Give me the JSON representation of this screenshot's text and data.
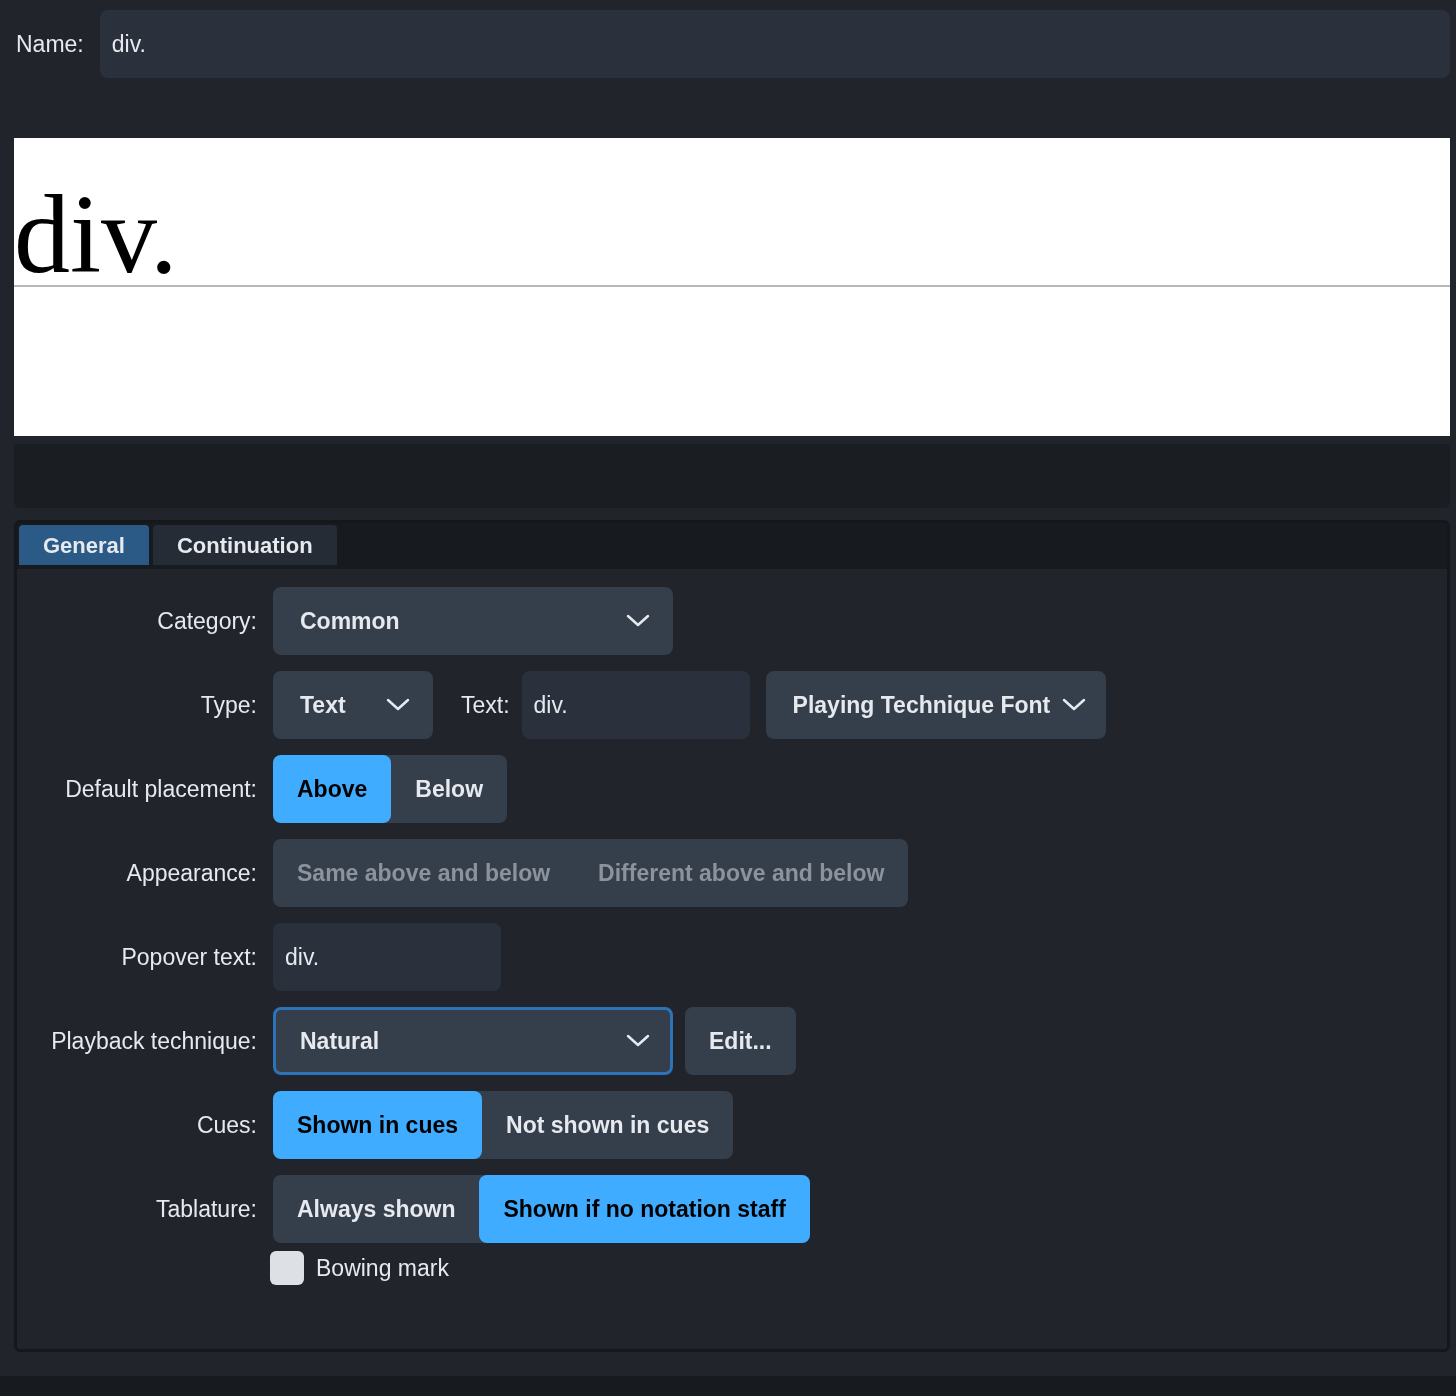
{
  "name_field": {
    "label": "Name:",
    "value": "div."
  },
  "preview": {
    "text": "div."
  },
  "tabs": [
    {
      "label": "General",
      "selected": true
    },
    {
      "label": "Continuation",
      "selected": false
    }
  ],
  "form": [
    {
      "kind": "dropdown",
      "label": "Category:",
      "value": "Common",
      "focused": false
    },
    {
      "kind": "type",
      "label": "Type:",
      "type_value": "Text",
      "text_label": "Text:",
      "text_value": "div.",
      "font_value": "Playing Technique Font"
    },
    {
      "kind": "segmented",
      "label": "Default placement:",
      "disabled": false,
      "options": [
        {
          "label": "Above",
          "selected": true
        },
        {
          "label": "Below",
          "selected": false
        }
      ]
    },
    {
      "kind": "segmented",
      "label": "Appearance:",
      "disabled": true,
      "options": [
        {
          "label": "Same above and below",
          "selected": false
        },
        {
          "label": "Different above and below",
          "selected": false
        }
      ]
    },
    {
      "kind": "field",
      "label": "Popover text:",
      "value": "div."
    },
    {
      "kind": "dropdown",
      "label": "Playback technique:",
      "value": "Natural",
      "focused": true,
      "button": "Edit..."
    },
    {
      "kind": "segmented",
      "label": "Cues:",
      "disabled": false,
      "options": [
        {
          "label": "Shown in cues",
          "selected": true
        },
        {
          "label": "Not shown in cues",
          "selected": false
        }
      ]
    },
    {
      "kind": "segmented",
      "label": "Tablature:",
      "disabled": false,
      "options": [
        {
          "label": "Always shown",
          "selected": false
        },
        {
          "label": "Shown if no notation staff",
          "selected": true
        }
      ]
    }
  ],
  "checkbox": {
    "label": "Bowing mark",
    "checked": false
  }
}
